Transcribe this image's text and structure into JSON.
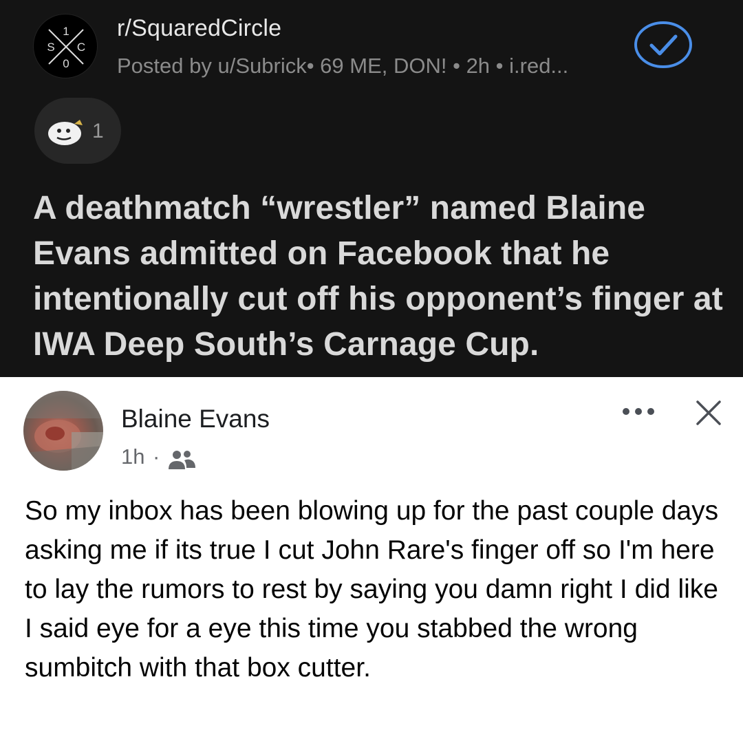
{
  "reddit": {
    "subreddit": "r/SquaredCircle",
    "post_meta": "Posted by u/Subrick• 69 ME, DON! • 2h • i.red...",
    "award_count": "1",
    "post_title": "A deathmatch “wrestler” named Blaine Evans admitted on Facebook that he intentionally cut off his opponent’s finger at IWA Deep South’s Carnage Cup.",
    "logo_letters": {
      "top": "1",
      "left": "S",
      "right": "C",
      "bottom": "0"
    },
    "accent_color": "#4a8ee8"
  },
  "facebook": {
    "author": "Blaine Evans",
    "time": "1h",
    "separator": "·",
    "post_text": "So my inbox has been blowing up for the past couple days asking me if its true I cut John Rare's finger off so I'm here to lay the rumors to rest by saying you damn right I did like I said eye for a eye this time you stabbed the wrong sumbitch with that box cutter."
  },
  "icons": [
    "subreddit-logo",
    "checkmark-icon",
    "award-icon",
    "friends-icon",
    "more-icon",
    "close-icon"
  ]
}
